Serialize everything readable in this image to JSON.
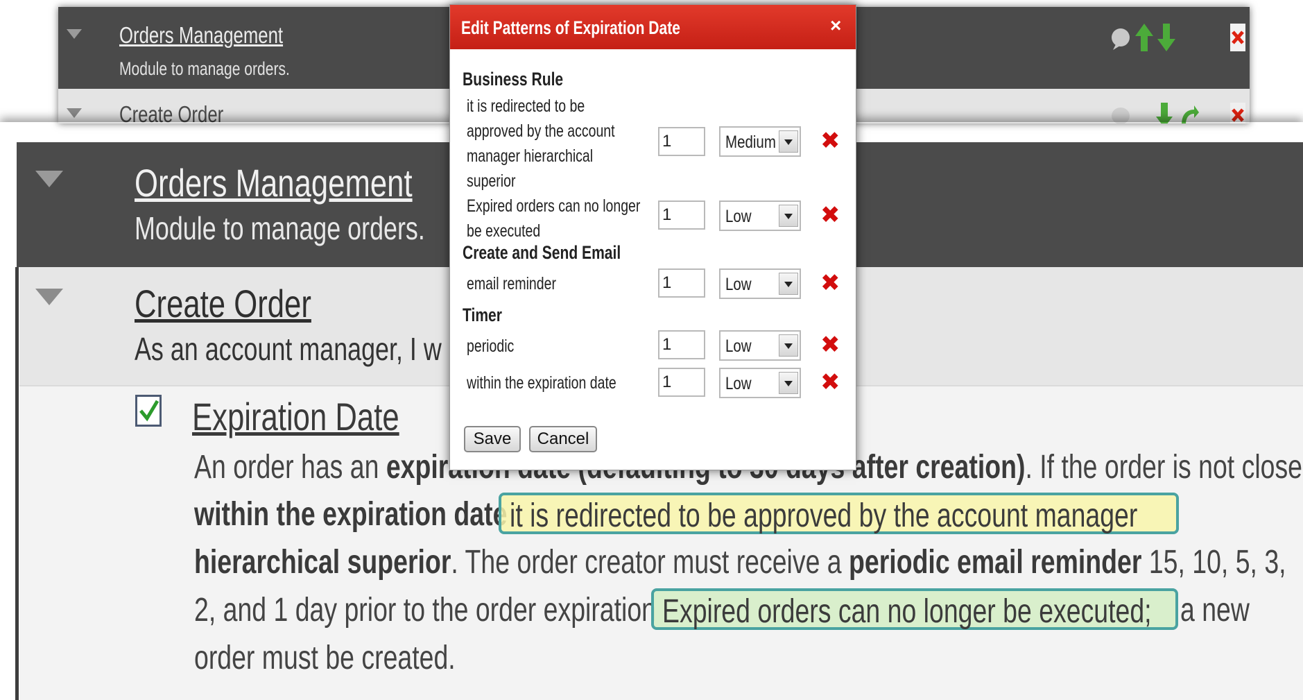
{
  "bg_panel": {
    "module_title": "Orders Management",
    "module_desc": "Module to manage orders.",
    "create_order": "Create Order"
  },
  "main_panel": {
    "module_title": "Orders Management",
    "module_desc": "Module to manage orders.",
    "create_order_title": "Create Order",
    "create_order_desc": "As an account manager, I w",
    "expiration_title": "Expiration Date",
    "expiration_checked": true,
    "para": {
      "l1_a": "An order has an ",
      "l1_b": "expiration date (defaulting to 30 days after creation)",
      "l1_c": ". If the order is not closed",
      "l2_a": "within the expiration date",
      "l2_hl": "it is redirected to be approved by the account manager",
      "l3_a": "hierarchical superior",
      "l3_b": ". The order creator must receive a ",
      "l3_c": "periodic email reminder",
      "l3_d": " 15, 10, 5, 3,",
      "l4_a": "2, and 1 day prior to the order expiration",
      "l4_hl": "Expired orders can no longer be executed;",
      "l4_b": "a new",
      "l5": "order must be created."
    },
    "highlight_colors": {
      "border": "#4aa3a1",
      "yellow": "#f8f4aa",
      "green": "#d6eec8"
    }
  },
  "dialog": {
    "title": "Edit Patterns of Expiration Date",
    "close": "×",
    "sections": {
      "business_rule": "Business Rule",
      "create_send_email": "Create and Send Email",
      "timer": "Timer"
    },
    "rows": {
      "r1": {
        "l1": "it is redirected to be",
        "l2": "approved by the account",
        "l3": "manager hierarchical",
        "l4": "superior",
        "value": "1",
        "priority": "Medium"
      },
      "r2": {
        "l1": "Expired orders can no longer",
        "l2": "be executed",
        "value": "1",
        "priority": "Low"
      },
      "r3": {
        "label": "email reminder",
        "value": "1",
        "priority": "Low"
      },
      "r4": {
        "label": "periodic",
        "value": "1",
        "priority": "Low"
      },
      "r5": {
        "label": "within the expiration date",
        "value": "1",
        "priority": "Low"
      }
    },
    "delete_icon": "✖",
    "save": "Save",
    "cancel": "Cancel",
    "header_color": "#d42a1e"
  }
}
